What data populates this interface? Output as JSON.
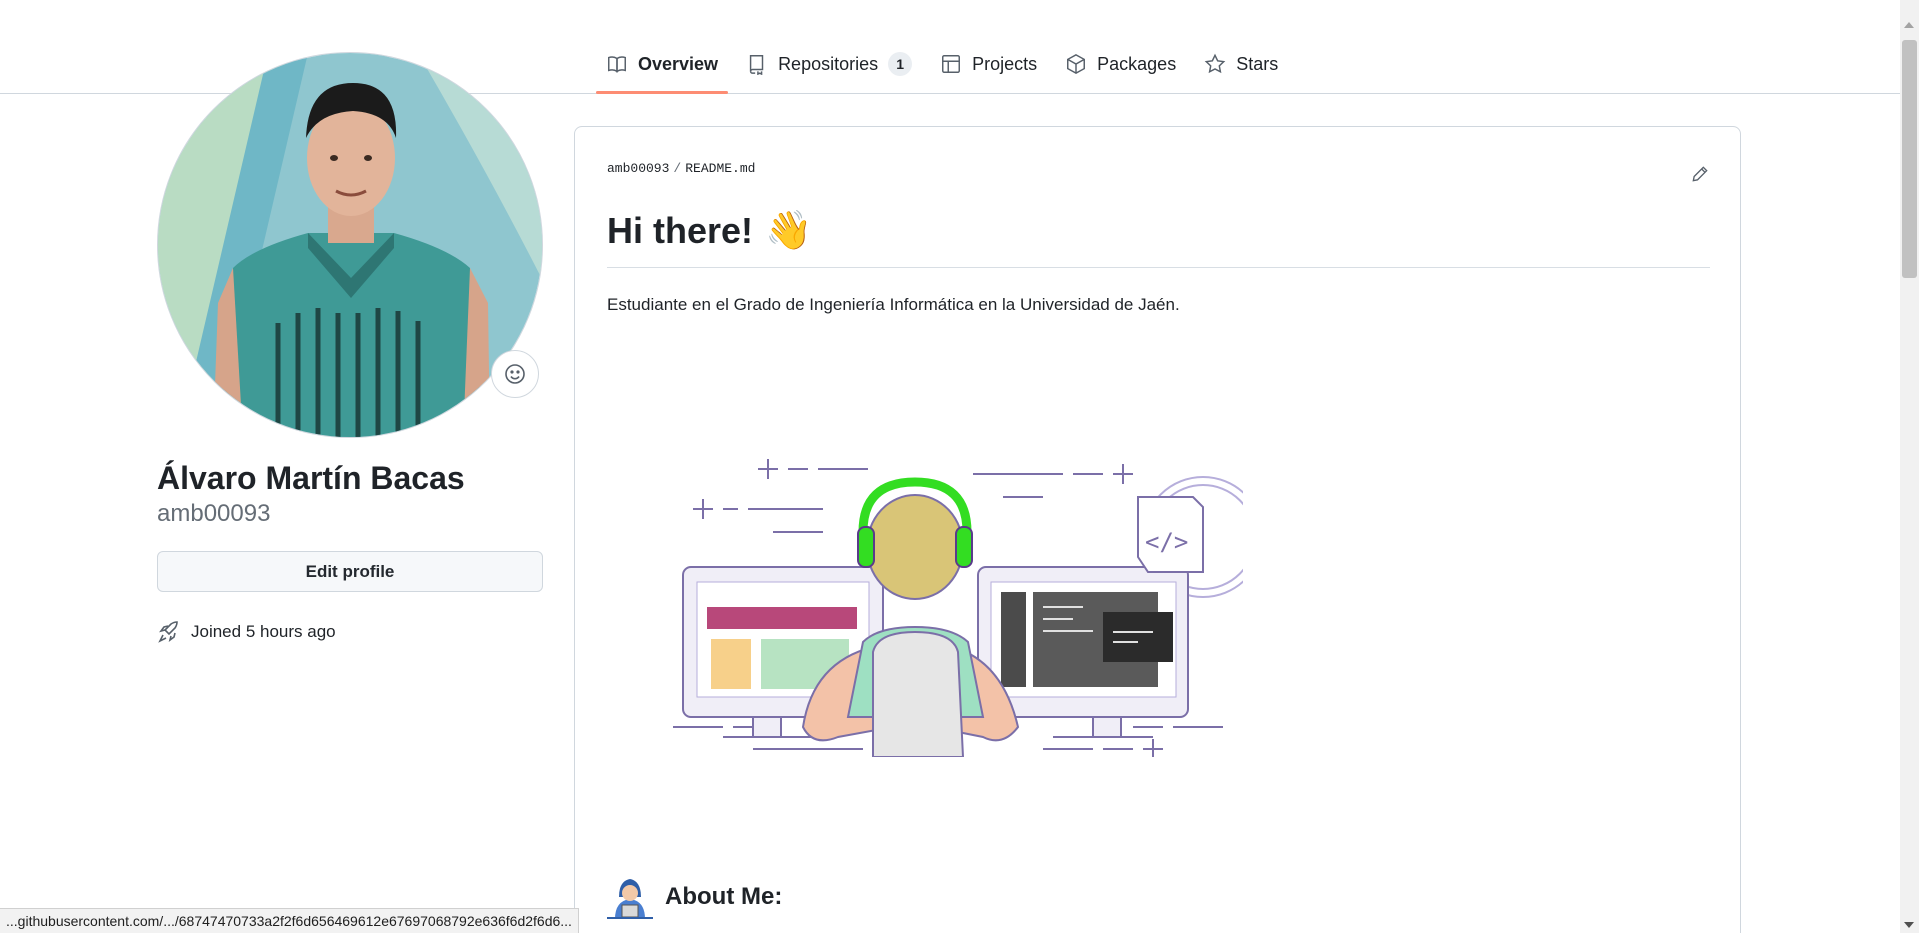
{
  "tabs": [
    {
      "label": "Overview",
      "icon": "book-icon",
      "active": true
    },
    {
      "label": "Repositories",
      "icon": "repo-icon",
      "count": "1"
    },
    {
      "label": "Projects",
      "icon": "table-icon"
    },
    {
      "label": "Packages",
      "icon": "package-icon"
    },
    {
      "label": "Stars",
      "icon": "star-icon"
    }
  ],
  "profile": {
    "full_name": "Álvaro Martín Bacas",
    "login": "amb00093",
    "edit_label": "Edit profile",
    "joined": "Joined 5 hours ago"
  },
  "readme": {
    "owner": "amb00093",
    "separator": "/",
    "file": "README.md",
    "heading": "Hi there!",
    "heading_emoji": "👋",
    "bio": "Estudiante en el Grado de Ingeniería Informática en la Universidad de Jaén.",
    "about_heading": "About Me:"
  },
  "status_bar": "...githubusercontent.com/.../68747470733a2f2f6d656469612e67697068792e636f6d2f6d6...",
  "colors": {
    "active_tab_underline": "#fd8c73",
    "border": "#d0d7de",
    "muted_text": "#656d76",
    "headphones": "#33dd22"
  }
}
